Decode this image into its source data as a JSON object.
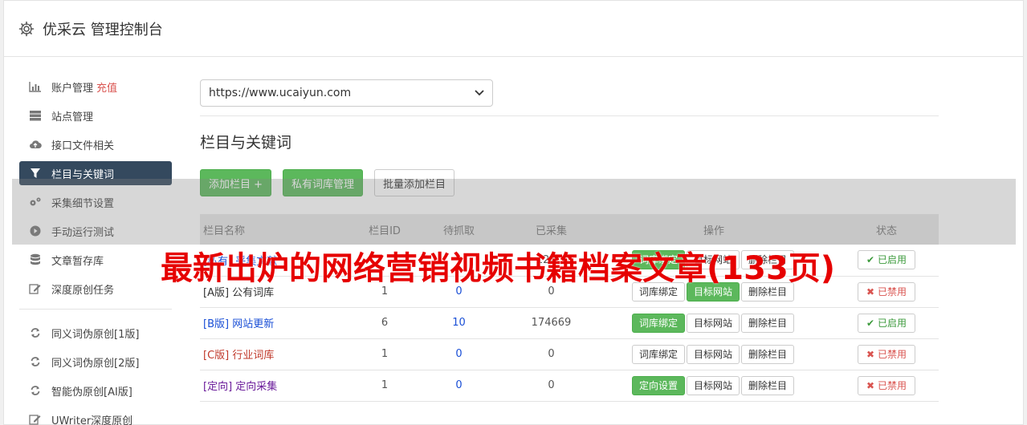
{
  "header": {
    "title": "优采云 管理控制台",
    "icon": "gear-icon"
  },
  "sidebar": {
    "items": [
      {
        "label": "账户管理",
        "extra": "充值",
        "icon": "bar-chart-icon"
      },
      {
        "label": "站点管理",
        "icon": "server-icon"
      },
      {
        "label": "接口文件相关",
        "icon": "cloud-upload-icon"
      },
      {
        "label": "栏目与关键词",
        "icon": "filter-icon",
        "active": true
      },
      {
        "label": "采集细节设置",
        "icon": "gears-icon"
      },
      {
        "label": "手动运行测试",
        "icon": "play-circle-icon"
      },
      {
        "label": "文章暂存库",
        "icon": "database-icon"
      },
      {
        "label": "深度原创任务",
        "icon": "edit-icon"
      }
    ],
    "items2": [
      {
        "label": "同义词伪原创[1版]",
        "icon": "refresh-icon"
      },
      {
        "label": "同义词伪原创[2版]",
        "icon": "refresh-icon"
      },
      {
        "label": "智能伪原创[AI版]",
        "icon": "refresh-icon"
      },
      {
        "label": "UWriter深度原创",
        "icon": "edit-icon"
      }
    ]
  },
  "main": {
    "site_select": "https://www.ucaiyun.com",
    "section_title": "栏目与关键词",
    "toolbar": {
      "add": "添加栏目 +",
      "private": "私有词库管理",
      "batch": "批量添加栏目"
    },
    "table": {
      "headers": [
        "栏目名称",
        "栏目ID",
        "待抓取",
        "已采集",
        "操作",
        "状态"
      ],
      "rows": [
        {
          "name": "[私有] 采集文献",
          "id": "",
          "pending": "",
          "collected": "124...",
          "actions": [
            "词库绑定",
            "目标网站",
            "删除栏目"
          ],
          "status": "已启用"
        },
        {
          "name": "[A版] 公有词库",
          "id": "1",
          "pending": "0",
          "collected": "0",
          "actions": [
            "词库绑定",
            "目标网站",
            "删除栏目"
          ],
          "status": "已禁用"
        },
        {
          "name": "[B版] 网站更新",
          "id": "6",
          "pending": "10",
          "collected": "174669",
          "actions": [
            "词库绑定",
            "目标网站",
            "删除栏目"
          ],
          "status": "已启用"
        },
        {
          "name": "[C版] 行业词库",
          "id": "1",
          "pending": "0",
          "collected": "0",
          "actions": [
            "词库绑定",
            "目标网站",
            "删除栏目"
          ],
          "status": "已禁用"
        },
        {
          "name": "[定向] 定向采集",
          "id": "1",
          "pending": "0",
          "collected": "0",
          "actions": [
            "定向设置",
            "目标网站",
            "删除栏目"
          ],
          "status": "已禁用"
        }
      ]
    }
  },
  "overlay": {
    "text": "最新出炉的网络营销视频书籍档案文章(133页)"
  },
  "colors": {
    "active_nav": "#34495e",
    "green": "#5cb85c",
    "red_text": "#e60000"
  }
}
